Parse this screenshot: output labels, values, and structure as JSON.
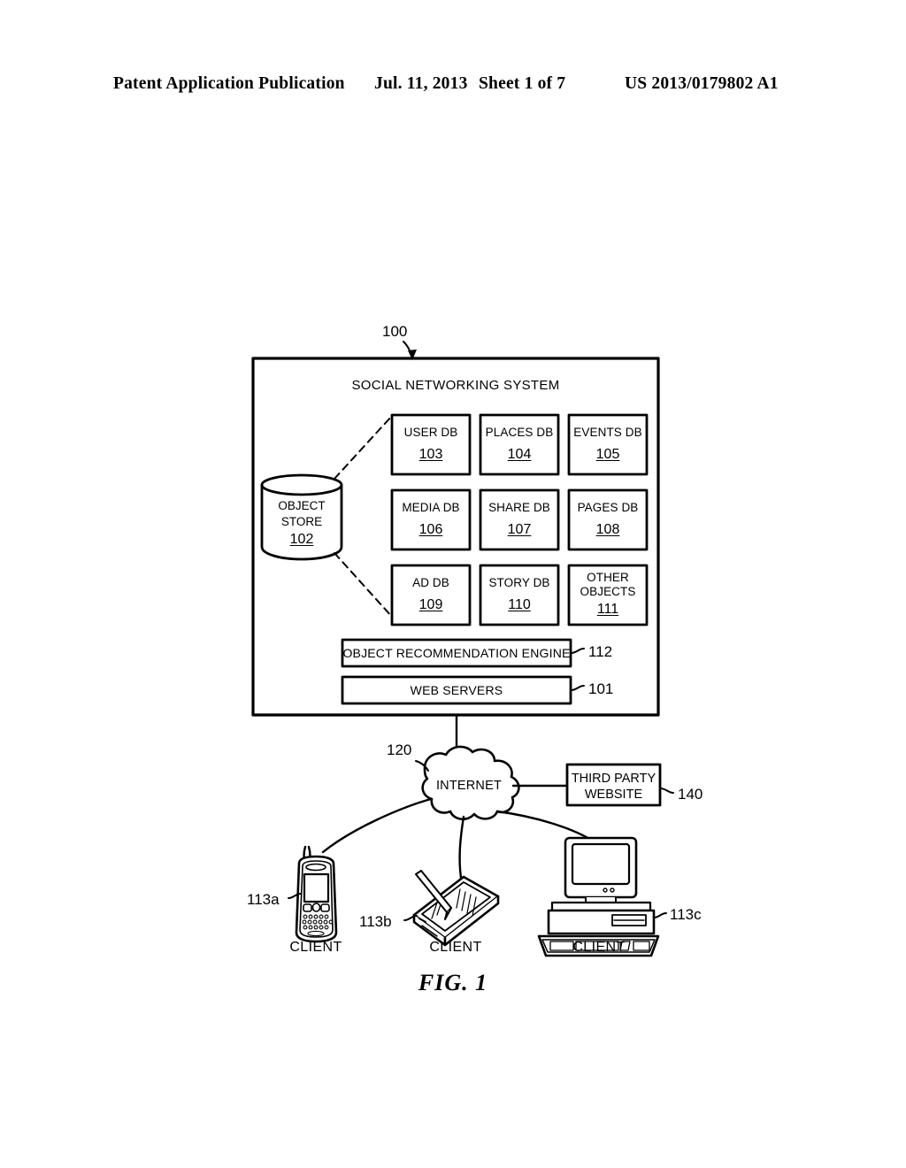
{
  "header": {
    "left": "Patent Application Publication",
    "date": "Jul. 11, 2013",
    "sheet": "Sheet 1 of 7",
    "publication_number": "US 2013/0179802 A1"
  },
  "figure": {
    "caption": "FIG. 1",
    "system": {
      "title": "SOCIAL NETWORKING SYSTEM",
      "ref": "100"
    },
    "object_store": {
      "line1": "OBJECT",
      "line2": "STORE",
      "ref": "102"
    },
    "databases": [
      {
        "name": "USER DB",
        "ref": "103"
      },
      {
        "name": "PLACES DB",
        "ref": "104"
      },
      {
        "name": "EVENTS DB",
        "ref": "105"
      },
      {
        "name": "MEDIA DB",
        "ref": "106"
      },
      {
        "name": "SHARE DB",
        "ref": "107"
      },
      {
        "name": "PAGES DB",
        "ref": "108"
      },
      {
        "name": "AD DB",
        "ref": "109"
      },
      {
        "name": "STORY DB",
        "ref": "110"
      }
    ],
    "other_objects": {
      "line1": "OTHER",
      "line2": "OBJECTS",
      "ref": "111"
    },
    "bars": [
      {
        "label": "OBJECT RECOMMENDATION ENGINE",
        "ref": "112"
      },
      {
        "label": "WEB SERVERS",
        "ref": "101"
      }
    ],
    "internet": {
      "label": "INTERNET",
      "ref": "120"
    },
    "third_party": {
      "line1": "THIRD PARTY",
      "line2": "WEBSITE",
      "ref": "140"
    },
    "clients": [
      {
        "label": "CLIENT",
        "ref": "113a",
        "device": "smartphone"
      },
      {
        "label": "CLIENT",
        "ref": "113b",
        "device": "tablet"
      },
      {
        "label": "CLIENT",
        "ref": "113c",
        "device": "desktop-computer"
      }
    ]
  },
  "colors": {
    "ink": "#000000",
    "paper": "#ffffff"
  }
}
